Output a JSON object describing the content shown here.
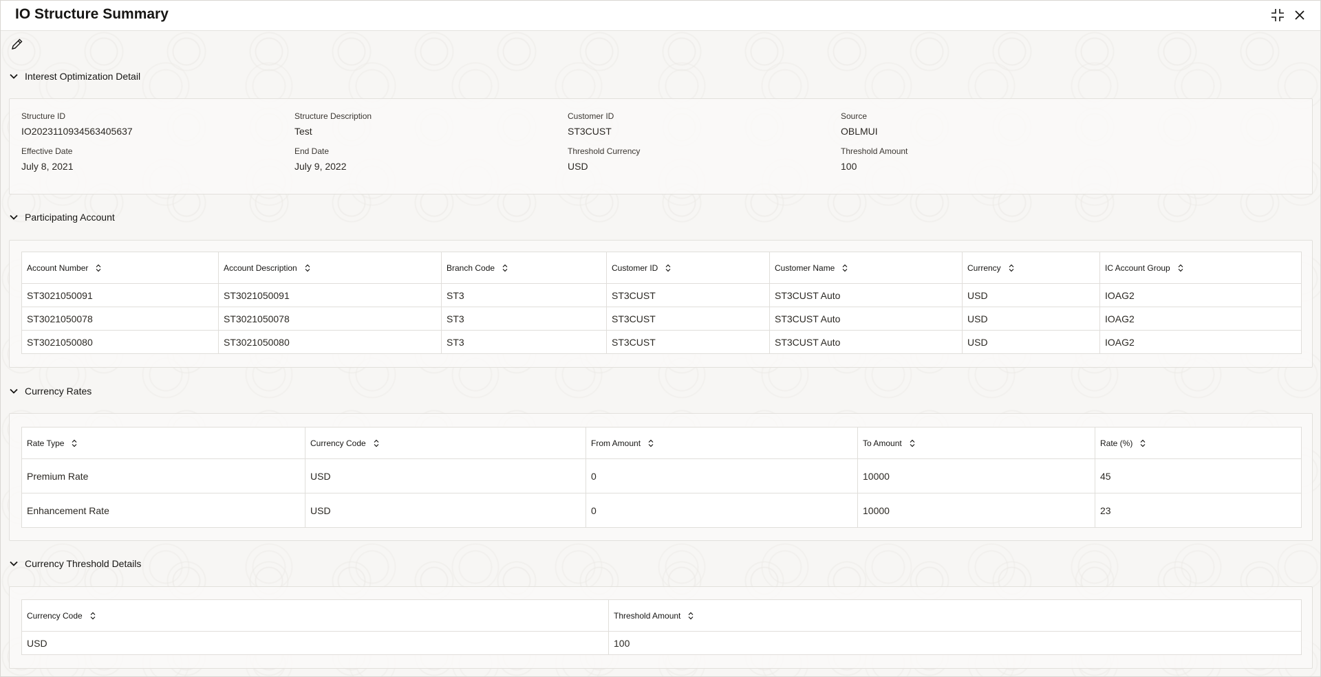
{
  "window": {
    "title": "IO Structure Summary"
  },
  "header": {
    "minimize_icon": "collapse-icon",
    "close_icon": "close-icon"
  },
  "toolbar": {
    "edit_icon": "pencil-icon"
  },
  "sections": {
    "interest": {
      "title": "Interest Optimization Detail",
      "fields": [
        {
          "label": "Structure ID",
          "value": "IO2023110934563405637"
        },
        {
          "label": "Structure Description",
          "value": "Test"
        },
        {
          "label": "Customer ID",
          "value": "ST3CUST"
        },
        {
          "label": "Source",
          "value": "OBLMUI"
        },
        {
          "label": "Effective Date",
          "value": "July 8, 2021"
        },
        {
          "label": "End Date",
          "value": "July 9, 2022"
        },
        {
          "label": "Threshold Currency",
          "value": "USD"
        },
        {
          "label": "Threshold Amount",
          "value": "100"
        }
      ]
    },
    "participating": {
      "title": "Participating Account",
      "columns": [
        "Account Number",
        "Account Description",
        "Branch Code",
        "Customer ID",
        "Customer Name",
        "Currency",
        "IC Account Group"
      ],
      "rows": [
        [
          "ST3021050091",
          "ST3021050091",
          "ST3",
          "ST3CUST",
          "ST3CUST Auto",
          "USD",
          "IOAG2"
        ],
        [
          "ST3021050078",
          "ST3021050078",
          "ST3",
          "ST3CUST",
          "ST3CUST Auto",
          "USD",
          "IOAG2"
        ],
        [
          "ST3021050080",
          "ST3021050080",
          "ST3",
          "ST3CUST",
          "ST3CUST Auto",
          "USD",
          "IOAG2"
        ]
      ]
    },
    "rates": {
      "title": "Currency Rates",
      "columns": [
        "Rate Type",
        "Currency Code",
        "From Amount",
        "To Amount",
        "Rate (%)"
      ],
      "rows": [
        [
          "Premium Rate",
          "USD",
          "0",
          "10000",
          "45"
        ],
        [
          "Enhancement Rate",
          "USD",
          "0",
          "10000",
          "23"
        ]
      ]
    },
    "threshold": {
      "title": "Currency Threshold Details",
      "columns": [
        "Currency Code",
        "Threshold Amount"
      ],
      "rows": [
        [
          "USD",
          "100"
        ]
      ]
    }
  }
}
